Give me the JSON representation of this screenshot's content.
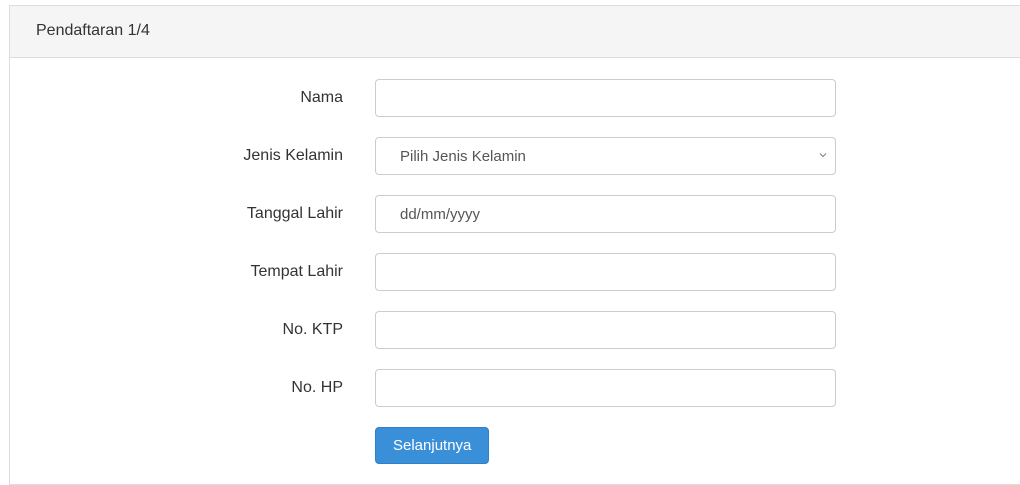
{
  "card": {
    "title": "Pendaftaran 1/4"
  },
  "form": {
    "nama": {
      "label": "Nama",
      "value": ""
    },
    "jenis_kelamin": {
      "label": "Jenis Kelamin",
      "selected": "Pilih Jenis Kelamin"
    },
    "tanggal_lahir": {
      "label": "Tanggal Lahir",
      "placeholder": "dd/mm/yyyy"
    },
    "tempat_lahir": {
      "label": "Tempat Lahir",
      "value": ""
    },
    "no_ktp": {
      "label": "No. KTP",
      "value": ""
    },
    "no_hp": {
      "label": "No. HP",
      "value": ""
    },
    "submit_label": "Selanjutnya"
  },
  "icons": {
    "select_chevron": "chevron-down-icon"
  },
  "colors": {
    "primary_button": "#3a8fd9",
    "header_background": "#f5f5f5",
    "border": "#dddddd"
  }
}
